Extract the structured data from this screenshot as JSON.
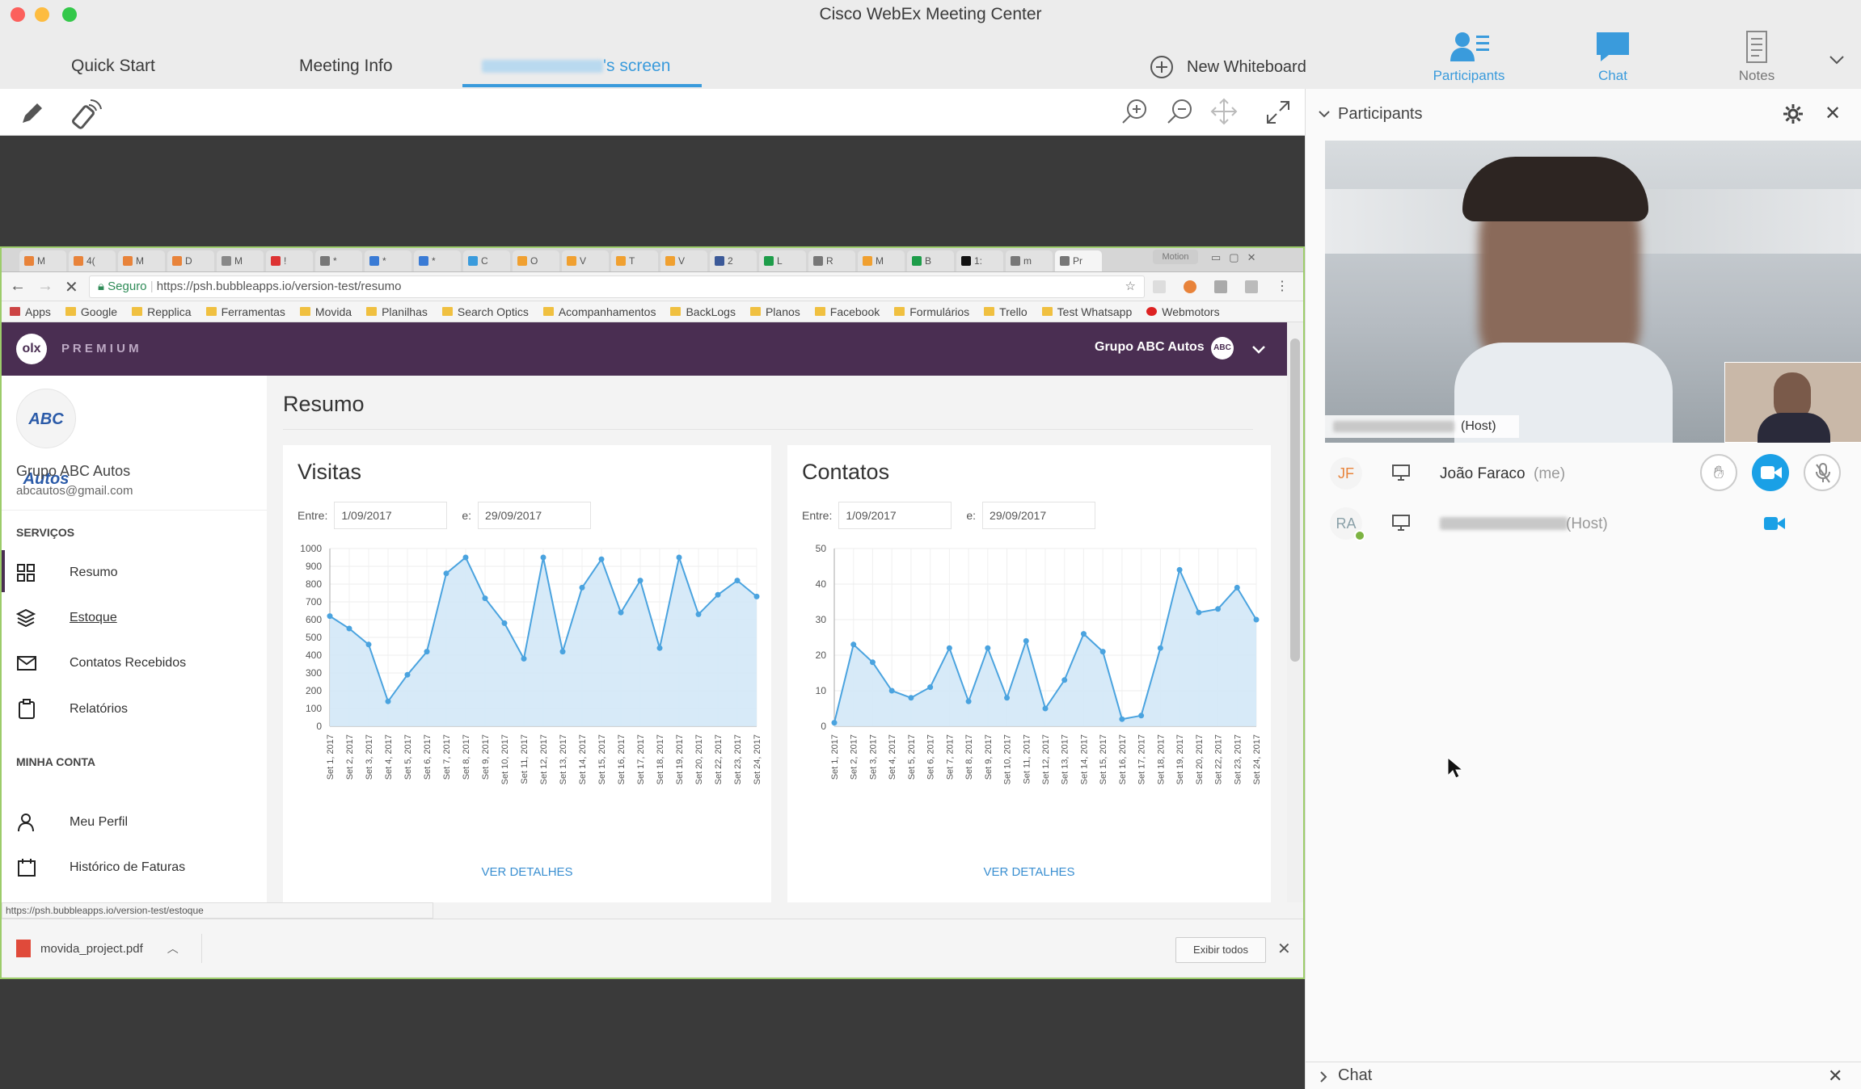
{
  "app": {
    "window_title": "Cisco WebEx Meeting Center"
  },
  "tabs": {
    "quick_start": "Quick Start",
    "meeting_info": "Meeting Info",
    "screen_suffix": "'s screen",
    "new_whiteboard": "New Whiteboard"
  },
  "right_tools": {
    "participants": "Participants",
    "chat": "Chat",
    "notes": "Notes"
  },
  "panel": {
    "title": "Participants",
    "host_label": "(Host)",
    "participants": [
      {
        "initials": "JF",
        "name": "João Faraco",
        "suffix": "(me)"
      },
      {
        "initials": "RA",
        "name": "",
        "suffix": "(Host)"
      }
    ],
    "chat_label": "Chat"
  },
  "browser": {
    "tabs": [
      "M",
      "4(",
      "M",
      "D",
      "M",
      "!",
      "*",
      "*",
      "*",
      "C",
      "O",
      "V",
      "T",
      "V",
      "2",
      "L",
      "R",
      "M",
      "B",
      "1:",
      "m",
      "Pr"
    ],
    "profile": "Motion",
    "url_secure": "Seguro",
    "url": "https://psh.bubbleapps.io/version-test/resumo",
    "bookmarks": [
      "Apps",
      "Google",
      "Repplica",
      "Ferramentas",
      "Movida",
      "Planilhas",
      "Search Optics",
      "Acompanhamentos",
      "BackLogs",
      "Planos",
      "Facebook",
      "Formulários",
      "Trello",
      "Test Whatsapp",
      "Webmotors"
    ],
    "status_url": "https://psh.bubbleapps.io/version-test/estoque",
    "download_file": "movida_project.pdf",
    "show_all": "Exibir todos"
  },
  "app_page": {
    "logo_text": "olx",
    "premium": "P R E M I U M",
    "company_header": "Grupo ABC Autos",
    "company_logo": "ABC Autos",
    "company_name": "Grupo ABC Autos",
    "company_email": "abcautos@gmail.com",
    "section_services": "SERVIÇOS",
    "menu": [
      "Resumo",
      "Estoque",
      "Contatos Recebidos",
      "Relatórios"
    ],
    "section_account": "MINHA CONTA",
    "account_menu": [
      "Meu Perfil",
      "Histórico de Faturas"
    ],
    "page_title": "Resumo",
    "date_from_label": "Entre:",
    "date_to_label": "e:",
    "date_from": "1/09/2017",
    "date_to": "29/09/2017",
    "ver_detalhes": "VER DETALHES"
  },
  "chart_data": [
    {
      "type": "area",
      "title": "Visitas",
      "categories": [
        "Set 1, 2017",
        "Set 2, 2017",
        "Set 3, 2017",
        "Set 4, 2017",
        "Set 5, 2017",
        "Set 6, 2017",
        "Set 7, 2017",
        "Set 8, 2017",
        "Set 9, 2017",
        "Set 10, 2017",
        "Set 11, 2017",
        "Set 12, 2017",
        "Set 13, 2017",
        "Set 14, 2017",
        "Set 15, 2017",
        "Set 16, 2017",
        "Set 17, 2017",
        "Set 18, 2017",
        "Set 19, 2017",
        "Set 20, 2017",
        "Set 22, 2017",
        "Set 23, 2017",
        "Set 24, 2017"
      ],
      "values": [
        620,
        550,
        460,
        140,
        290,
        420,
        860,
        950,
        720,
        580,
        380,
        950,
        420,
        780,
        940,
        640,
        820,
        440,
        950,
        630,
        740,
        820,
        730
      ],
      "yticks": [
        0,
        100,
        200,
        300,
        400,
        500,
        600,
        700,
        800,
        900,
        1000
      ],
      "ylim": [
        0,
        1000
      ],
      "color": "#4aa3df",
      "fill": "#d3e8f7"
    },
    {
      "type": "area",
      "title": "Contatos",
      "categories": [
        "Set 1, 2017",
        "Set 2, 2017",
        "Set 3, 2017",
        "Set 4, 2017",
        "Set 5, 2017",
        "Set 6, 2017",
        "Set 7, 2017",
        "Set 8, 2017",
        "Set 9, 2017",
        "Set 10, 2017",
        "Set 11, 2017",
        "Set 12, 2017",
        "Set 13, 2017",
        "Set 14, 2017",
        "Set 15, 2017",
        "Set 16, 2017",
        "Set 17, 2017",
        "Set 18, 2017",
        "Set 19, 2017",
        "Set 20, 2017",
        "Set 22, 2017",
        "Set 23, 2017",
        "Set 24, 2017"
      ],
      "values": [
        1,
        23,
        18,
        10,
        8,
        11,
        22,
        7,
        22,
        8,
        24,
        5,
        13,
        26,
        21,
        2,
        3,
        22,
        44,
        32,
        33,
        39,
        30
      ],
      "yticks": [
        0,
        10,
        20,
        30,
        40,
        50
      ],
      "ylim": [
        0,
        50
      ],
      "color": "#4aa3df",
      "fill": "#d3e8f7"
    }
  ]
}
